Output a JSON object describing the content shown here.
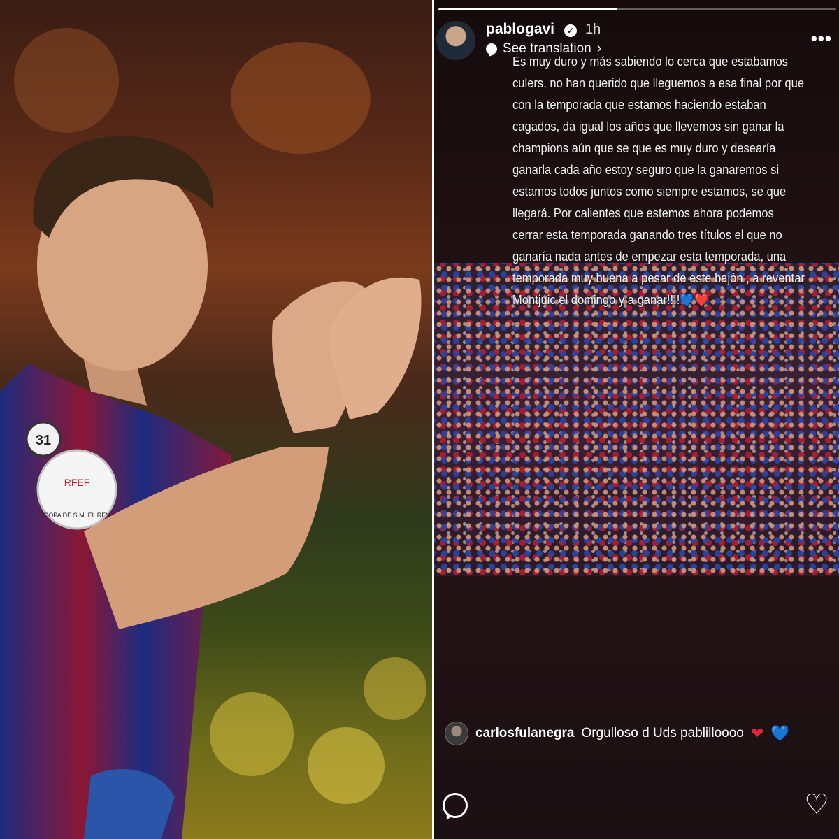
{
  "photo": {
    "description": "",
    "shirt_number_badge": "31",
    "patch_text": "COPA DE S.M. EL REY",
    "patch_letters": "RFEF"
  },
  "story": {
    "progress": 0.45,
    "username": "pablogavi",
    "verified_glyph": "✓",
    "time": "1h",
    "translate_label": "See translation",
    "more_glyph": "•••",
    "text": "Es muy duro y más sabiendo lo cerca que estabamos culers, no han querido que lleguemos a esa final por que con la temporada que estamos haciendo estaban cagados, da igual los años que llevemos sin ganar la champions aún que se que es muy duro y desearía ganarla cada año estoy seguro que la ganaremos si estamos todos juntos como siempre estamos, se que llegará. Por calientes que estemos ahora podemos cerrar esta temporada ganando tres títulos el que no ganaría nada antes de empezar esta temporada, una temporada muy buena a pesar de este bajón , a reventar Montjuic el domingo y a ganar!!!!💙❤️",
    "comment": {
      "user": "carlosfulanegra",
      "text": "Orgulloso d Uds pablilloooo",
      "heart_red": "❤",
      "heart_blue": "💙"
    },
    "like_glyph": "♡",
    "colors": {
      "heart_red": "#e0243a",
      "heart_blue": "#2c82ff"
    }
  }
}
